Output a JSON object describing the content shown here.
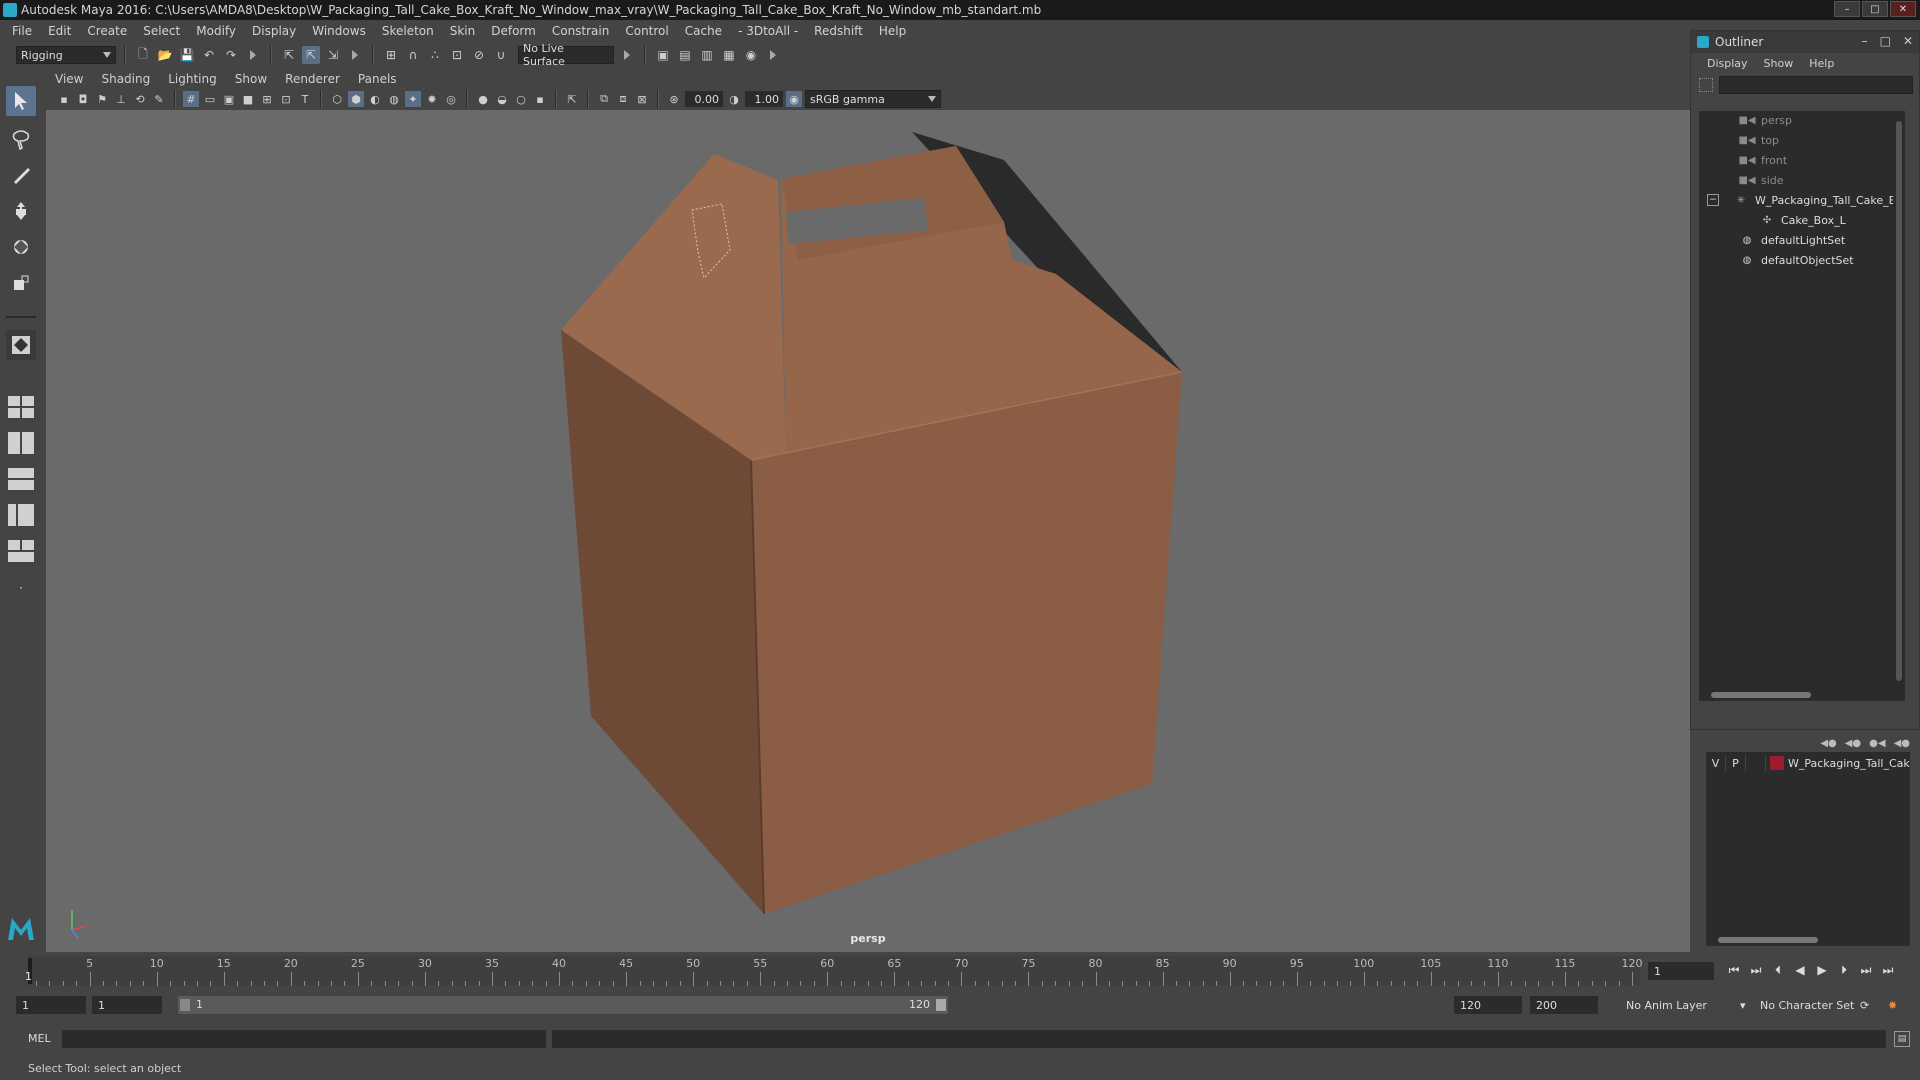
{
  "window": {
    "title": "Autodesk Maya 2016: C:\\Users\\AMDA8\\Desktop\\W_Packaging_Tall_Cake_Box_Kraft_No_Window_max_vray\\W_Packaging_Tall_Cake_Box_Kraft_No_Window_mb_standart.mb",
    "minimize": "–",
    "maximize": "□",
    "close": "✕"
  },
  "menubar": [
    "File",
    "Edit",
    "Create",
    "Select",
    "Modify",
    "Display",
    "Windows",
    "Skeleton",
    "Skin",
    "Deform",
    "Constrain",
    "Control",
    "Cache",
    "- 3DtoAll -",
    "Redshift",
    "Help"
  ],
  "statusline": {
    "mode": "Rigging",
    "live_surface": "No Live Surface"
  },
  "viewport": {
    "menu": [
      "View",
      "Shading",
      "Lighting",
      "Show",
      "Renderer",
      "Panels"
    ],
    "exposure": "0.00",
    "gamma": "1.00",
    "color_space": "sRGB gamma",
    "camera_label": "persp",
    "colors": {
      "background": "#6a6a6a",
      "box_front": "#8b5e45",
      "box_left": "#6f4a36",
      "box_top": "#9a6a4e",
      "box_shadow": "#2a2a2a"
    }
  },
  "outliner": {
    "title": "Outliner",
    "menu": [
      "Display",
      "Show",
      "Help"
    ],
    "items": [
      {
        "label": "persp",
        "icon": "camera-icon",
        "kind": "camera"
      },
      {
        "label": "top",
        "icon": "camera-icon",
        "kind": "camera"
      },
      {
        "label": "front",
        "icon": "camera-icon",
        "kind": "camera"
      },
      {
        "label": "side",
        "icon": "camera-icon",
        "kind": "camera"
      },
      {
        "label": "W_Packaging_Tall_Cake_Bo",
        "icon": "transform-icon",
        "kind": "group",
        "expander": "−"
      },
      {
        "label": "Cake_Box_L",
        "icon": "mesh-icon",
        "kind": "child"
      },
      {
        "label": "defaultLightSet",
        "icon": "set-icon",
        "kind": "set"
      },
      {
        "label": "defaultObjectSet",
        "icon": "set-icon",
        "kind": "set"
      }
    ]
  },
  "layer_editor": {
    "layers": [
      {
        "v": "V",
        "p": "P",
        "name": "W_Packaging_Tall_Cak",
        "color": "#9e1a2e"
      }
    ]
  },
  "timeline": {
    "current_frame": "1",
    "ticks": [
      "5",
      "10",
      "15",
      "20",
      "25",
      "30",
      "35",
      "40",
      "45",
      "50",
      "55",
      "60",
      "65",
      "70",
      "75",
      "80",
      "85",
      "90",
      "95",
      "100",
      "105",
      "110",
      "115",
      "120"
    ],
    "frame_field": "1",
    "range_start": "1",
    "range_start_inner": "1",
    "range_bar_start": "1",
    "range_bar_end": "120",
    "range_end": "120",
    "anim_end": "200",
    "anim_layer": "No Anim Layer",
    "character_set": "No Character Set"
  },
  "command": {
    "label": "MEL"
  },
  "help": {
    "text": "Select Tool: select an object"
  }
}
